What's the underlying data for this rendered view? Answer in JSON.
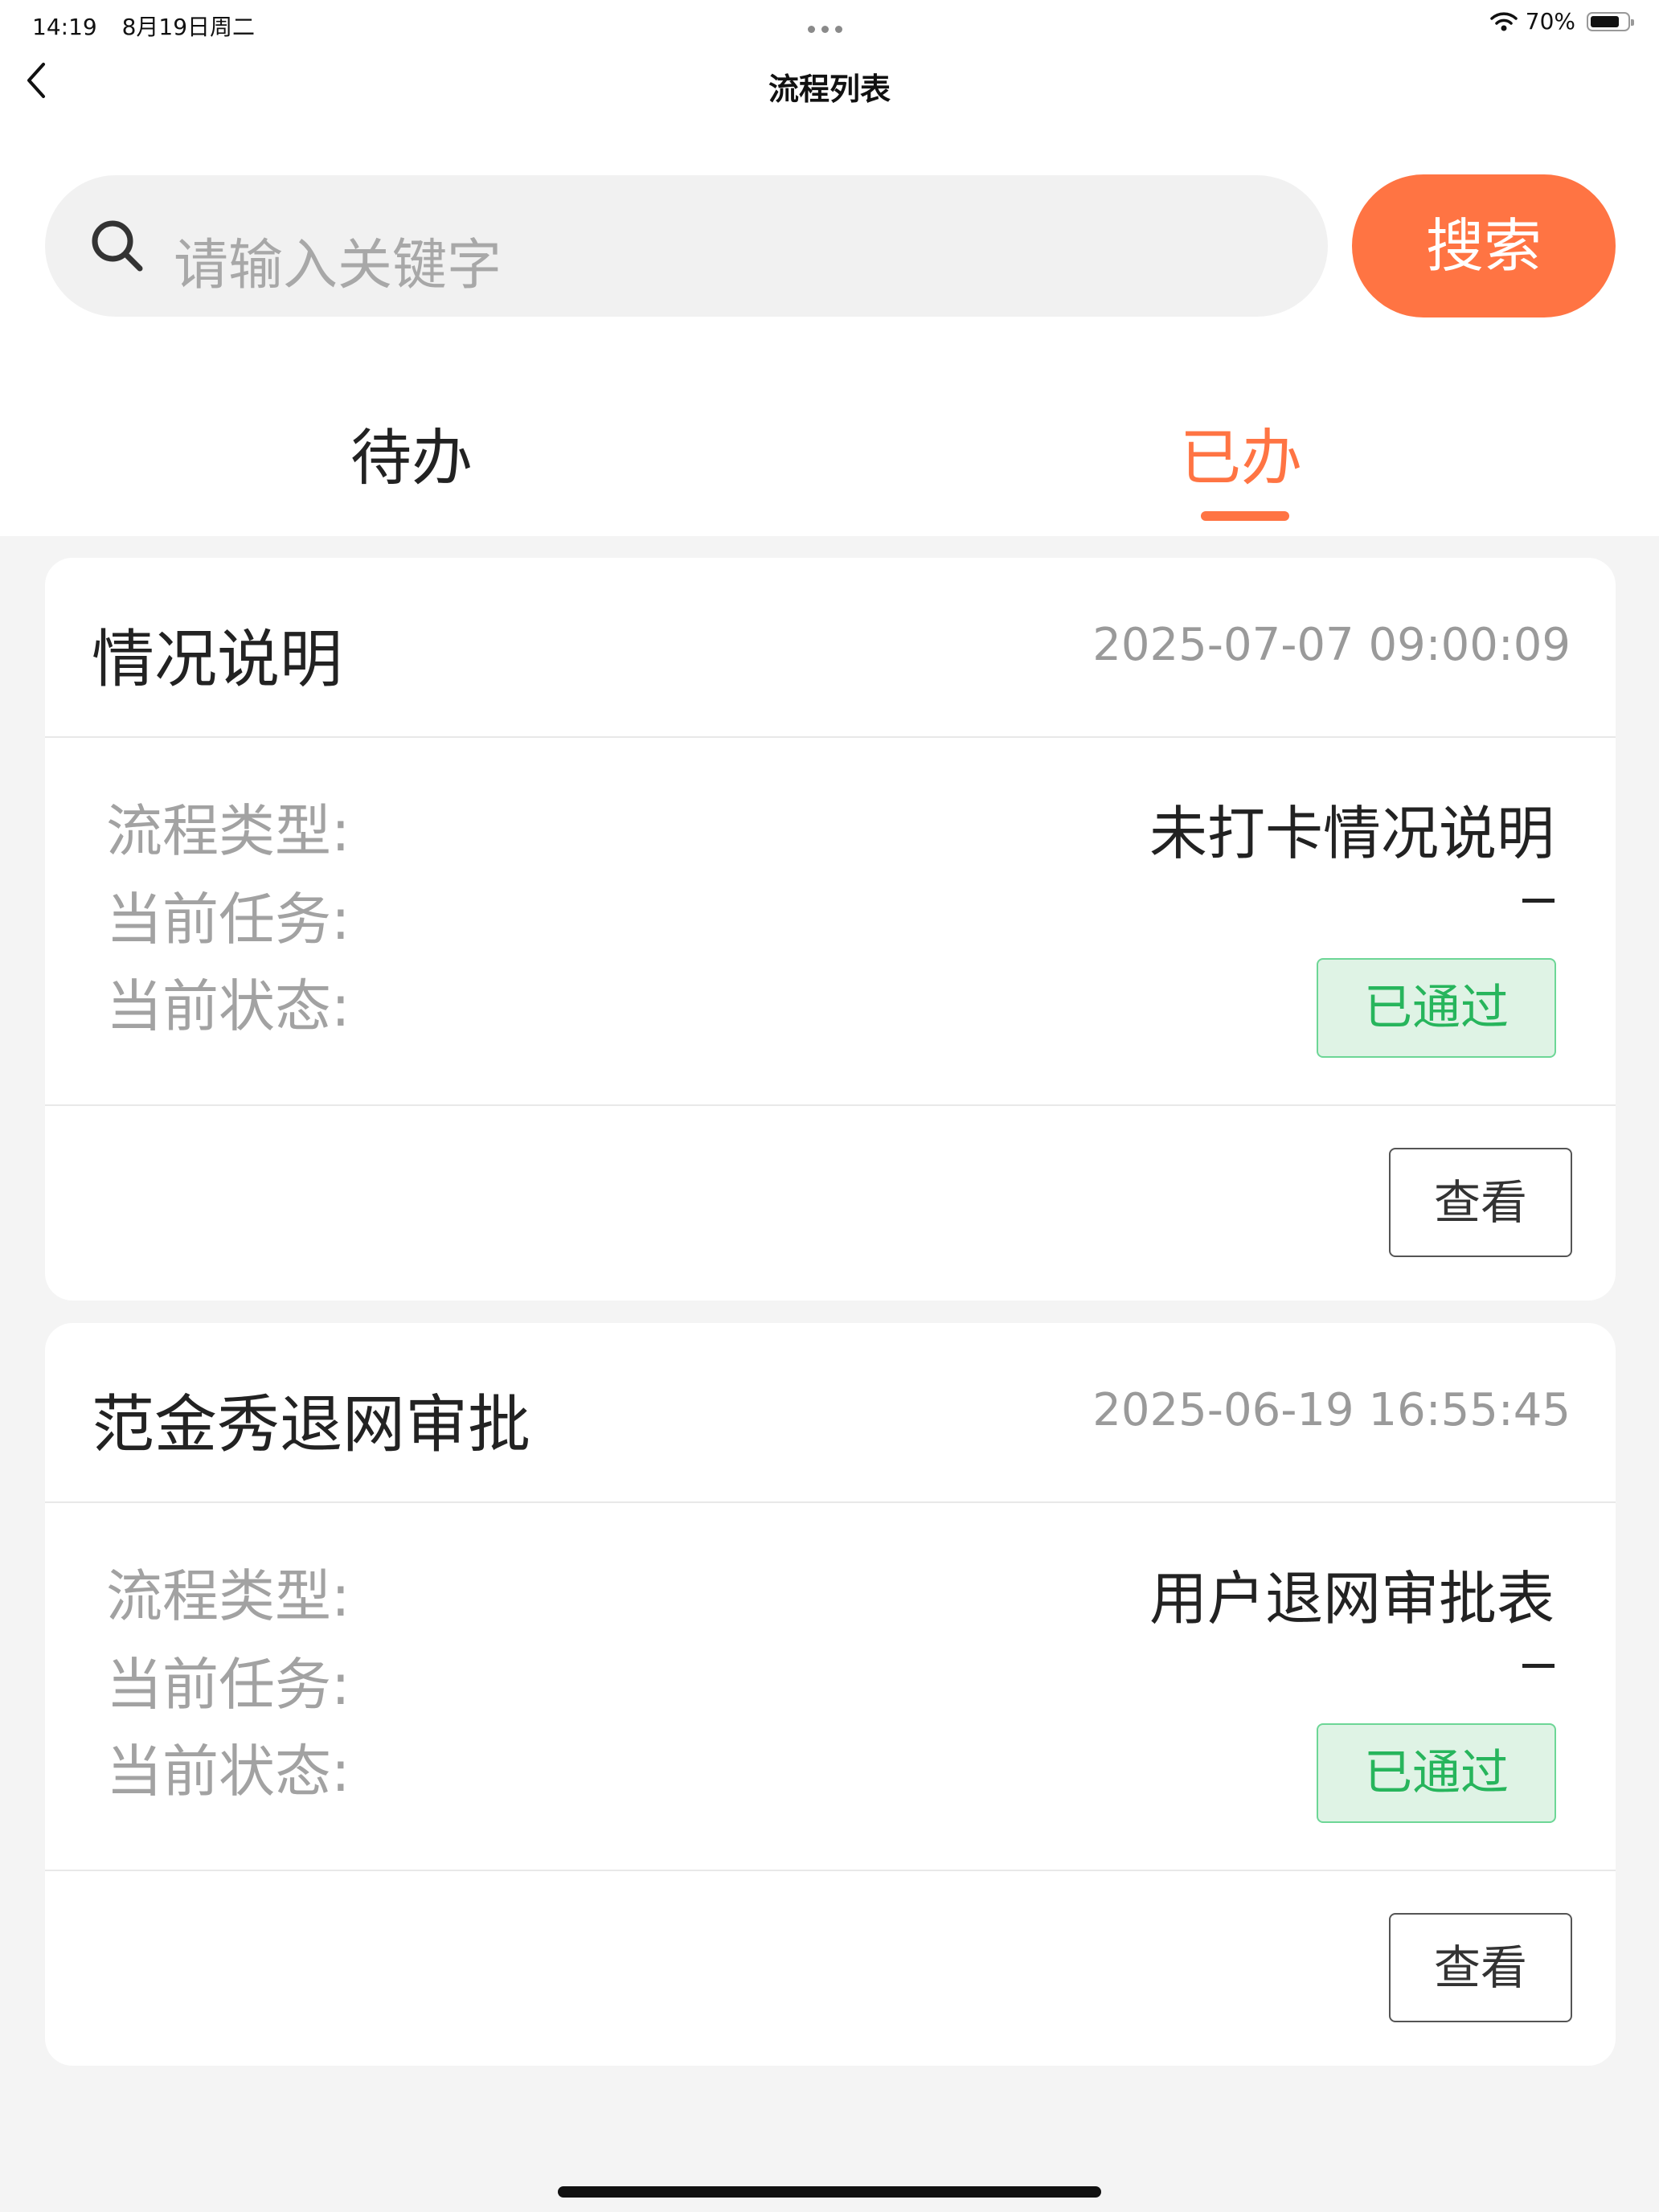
{
  "status_bar": {
    "time": "14:19",
    "date": "8月19日周二",
    "battery": "70%"
  },
  "nav": {
    "title": "流程列表"
  },
  "search": {
    "placeholder": "请输入关键字",
    "button_label": "搜索"
  },
  "tabs": [
    {
      "label": "待办",
      "active": false
    },
    {
      "label": "已办",
      "active": true
    }
  ],
  "colors": {
    "accent": "#ff7443",
    "status_ok": "#27b55c"
  },
  "cards": [
    {
      "title": "情况说明",
      "time": "2025-07-07 09:00:09",
      "type_label": "流程类型:",
      "type_value": "未打卡情况说明",
      "task_label": "当前任务:",
      "task_value": "–",
      "state_label": "当前状态:",
      "state_value": "已通过",
      "view_label": "查看"
    },
    {
      "title": "范金秀退网审批",
      "time": "2025-06-19 16:55:45",
      "type_label": "流程类型:",
      "type_value": "用户退网审批表",
      "task_label": "当前任务:",
      "task_value": "–",
      "state_label": "当前状态:",
      "state_value": "已通过",
      "view_label": "查看"
    }
  ]
}
